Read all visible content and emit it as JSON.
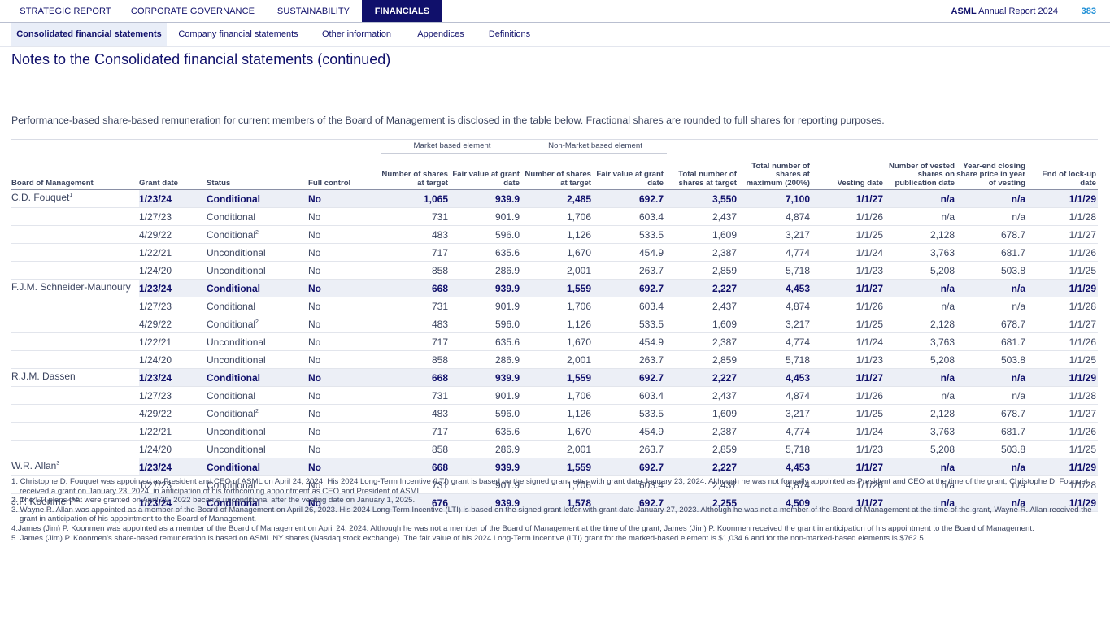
{
  "top_nav": {
    "tabs": [
      "STRATEGIC REPORT",
      "CORPORATE GOVERNANCE",
      "SUSTAINABILITY",
      "FINANCIALS"
    ],
    "active": 3,
    "brand_bold": "ASML",
    "brand_rest": " Annual Report 2024",
    "page_number": "383"
  },
  "sub_nav": {
    "tabs": [
      "Consolidated financial statements",
      "Company financial statements",
      "Other information",
      "Appendices",
      "Definitions"
    ],
    "active": 0
  },
  "page_title": "Notes to the Consolidated financial statements (continued)",
  "intro": "Performance-based share-based remuneration for current members of the Board of Management is disclosed in the table below. Fractional shares are rounded to full shares for reporting purposes.",
  "table": {
    "groups": {
      "market": "Market based element",
      "non_market": "Non-Market based element"
    },
    "headers": [
      "Board of Management",
      "Grant date",
      "Status",
      "Full control",
      "Number of shares at target",
      "Fair value at grant date",
      "Number of shares at target",
      "Fair value at grant date",
      "Total number of shares at target",
      "Total number of shares at maximum (200%)",
      "Vesting date",
      "Number of vested shares on publication date",
      "Year-end closing share price in year of vesting",
      "End of lock-up date"
    ],
    "members": [
      {
        "name": "C.D. Fouquet",
        "sup": "1",
        "rows": [
          {
            "grant": "1/23/24",
            "status": "Conditional",
            "ssup": "",
            "fc": "No",
            "m_shares": "1,065",
            "m_fv": "939.9",
            "n_shares": "2,485",
            "n_fv": "692.7",
            "total": "3,550",
            "max": "7,100",
            "vest": "1/1/27",
            "vested": "n/a",
            "price": "n/a",
            "lock": "1/1/29"
          },
          {
            "grant": "1/27/23",
            "status": "Conditional",
            "ssup": "",
            "fc": "No",
            "m_shares": "731",
            "m_fv": "901.9",
            "n_shares": "1,706",
            "n_fv": "603.4",
            "total": "2,437",
            "max": "4,874",
            "vest": "1/1/26",
            "vested": "n/a",
            "price": "n/a",
            "lock": "1/1/28"
          },
          {
            "grant": "4/29/22",
            "status": "Conditional",
            "ssup": "2",
            "fc": "No",
            "m_shares": "483",
            "m_fv": "596.0",
            "n_shares": "1,126",
            "n_fv": "533.5",
            "total": "1,609",
            "max": "3,217",
            "vest": "1/1/25",
            "vested": "2,128",
            "price": "678.7",
            "lock": "1/1/27"
          },
          {
            "grant": "1/22/21",
            "status": "Unconditional",
            "ssup": "",
            "fc": "No",
            "m_shares": "717",
            "m_fv": "635.6",
            "n_shares": "1,670",
            "n_fv": "454.9",
            "total": "2,387",
            "max": "4,774",
            "vest": "1/1/24",
            "vested": "3,763",
            "price": "681.7",
            "lock": "1/1/26"
          },
          {
            "grant": "1/24/20",
            "status": "Unconditional",
            "ssup": "",
            "fc": "No",
            "m_shares": "858",
            "m_fv": "286.9",
            "n_shares": "2,001",
            "n_fv": "263.7",
            "total": "2,859",
            "max": "5,718",
            "vest": "1/1/23",
            "vested": "5,208",
            "price": "503.8",
            "lock": "1/1/25"
          }
        ]
      },
      {
        "name": "F.J.M. Schneider-Maunoury",
        "sup": "",
        "rows": [
          {
            "grant": "1/23/24",
            "status": "Conditional",
            "ssup": "",
            "fc": "No",
            "m_shares": "668",
            "m_fv": "939.9",
            "n_shares": "1,559",
            "n_fv": "692.7",
            "total": "2,227",
            "max": "4,453",
            "vest": "1/1/27",
            "vested": "n/a",
            "price": "n/a",
            "lock": "1/1/29"
          },
          {
            "grant": "1/27/23",
            "status": "Conditional",
            "ssup": "",
            "fc": "No",
            "m_shares": "731",
            "m_fv": "901.9",
            "n_shares": "1,706",
            "n_fv": "603.4",
            "total": "2,437",
            "max": "4,874",
            "vest": "1/1/26",
            "vested": "n/a",
            "price": "n/a",
            "lock": "1/1/28"
          },
          {
            "grant": "4/29/22",
            "status": "Conditional",
            "ssup": "2",
            "fc": "No",
            "m_shares": "483",
            "m_fv": "596.0",
            "n_shares": "1,126",
            "n_fv": "533.5",
            "total": "1,609",
            "max": "3,217",
            "vest": "1/1/25",
            "vested": "2,128",
            "price": "678.7",
            "lock": "1/1/27"
          },
          {
            "grant": "1/22/21",
            "status": "Unconditional",
            "ssup": "",
            "fc": "No",
            "m_shares": "717",
            "m_fv": "635.6",
            "n_shares": "1,670",
            "n_fv": "454.9",
            "total": "2,387",
            "max": "4,774",
            "vest": "1/1/24",
            "vested": "3,763",
            "price": "681.7",
            "lock": "1/1/26"
          },
          {
            "grant": "1/24/20",
            "status": "Unconditional",
            "ssup": "",
            "fc": "No",
            "m_shares": "858",
            "m_fv": "286.9",
            "n_shares": "2,001",
            "n_fv": "263.7",
            "total": "2,859",
            "max": "5,718",
            "vest": "1/1/23",
            "vested": "5,208",
            "price": "503.8",
            "lock": "1/1/25"
          }
        ]
      },
      {
        "name": "R.J.M. Dassen",
        "sup": "",
        "rows": [
          {
            "grant": "1/23/24",
            "status": "Conditional",
            "ssup": "",
            "fc": "No",
            "m_shares": "668",
            "m_fv": "939.9",
            "n_shares": "1,559",
            "n_fv": "692.7",
            "total": "2,227",
            "max": "4,453",
            "vest": "1/1/27",
            "vested": "n/a",
            "price": "n/a",
            "lock": "1/1/29"
          },
          {
            "grant": "1/27/23",
            "status": "Conditional",
            "ssup": "",
            "fc": "No",
            "m_shares": "731",
            "m_fv": "901.9",
            "n_shares": "1,706",
            "n_fv": "603.4",
            "total": "2,437",
            "max": "4,874",
            "vest": "1/1/26",
            "vested": "n/a",
            "price": "n/a",
            "lock": "1/1/28"
          },
          {
            "grant": "4/29/22",
            "status": "Conditional",
            "ssup": "2",
            "fc": "No",
            "m_shares": "483",
            "m_fv": "596.0",
            "n_shares": "1,126",
            "n_fv": "533.5",
            "total": "1,609",
            "max": "3,217",
            "vest": "1/1/25",
            "vested": "2,128",
            "price": "678.7",
            "lock": "1/1/27"
          },
          {
            "grant": "1/22/21",
            "status": "Unconditional",
            "ssup": "",
            "fc": "No",
            "m_shares": "717",
            "m_fv": "635.6",
            "n_shares": "1,670",
            "n_fv": "454.9",
            "total": "2,387",
            "max": "4,774",
            "vest": "1/1/24",
            "vested": "3,763",
            "price": "681.7",
            "lock": "1/1/26"
          },
          {
            "grant": "1/24/20",
            "status": "Unconditional",
            "ssup": "",
            "fc": "No",
            "m_shares": "858",
            "m_fv": "286.9",
            "n_shares": "2,001",
            "n_fv": "263.7",
            "total": "2,859",
            "max": "5,718",
            "vest": "1/1/23",
            "vested": "5,208",
            "price": "503.8",
            "lock": "1/1/25"
          }
        ]
      },
      {
        "name": "W.R. Allan",
        "sup": "3",
        "rows": [
          {
            "grant": "1/23/24",
            "status": "Conditional",
            "ssup": "",
            "fc": "No",
            "m_shares": "668",
            "m_fv": "939.9",
            "n_shares": "1,559",
            "n_fv": "692.7",
            "total": "2,227",
            "max": "4,453",
            "vest": "1/1/27",
            "vested": "n/a",
            "price": "n/a",
            "lock": "1/1/29"
          },
          {
            "grant": "1/27/23",
            "status": "Conditional",
            "ssup": "",
            "fc": "No",
            "m_shares": "731",
            "m_fv": "901.9",
            "n_shares": "1,706",
            "n_fv": "603.4",
            "total": "2,437",
            "max": "4,874",
            "vest": "1/1/26",
            "vested": "n/a",
            "price": "n/a",
            "lock": "1/1/28"
          }
        ]
      },
      {
        "name": "J.P. Koonmen",
        "sup": "4,5",
        "rows": [
          {
            "grant": "1/23/24",
            "status": "Conditional",
            "ssup": "",
            "fc": "No",
            "m_shares": "676",
            "m_fv": "939.9",
            "n_shares": "1,578",
            "n_fv": "692.7",
            "total": "2,255",
            "max": "4,509",
            "vest": "1/1/27",
            "vested": "n/a",
            "price": "n/a",
            "lock": "1/1/29"
          }
        ]
      }
    ]
  },
  "footnotes": [
    "1. Christophe D. Fouquet was appointed as President and CEO of ASML on April 24, 2024. His 2024 Long-Term Incentive (LTI) grant is based on the signed grant letter with grant date January 23, 2024. Although he was not formally appointed as President and CEO at the time of the grant, Christophe D. Fouquet received a grant on January 23, 2024, in anticipation of his forthcoming appointment as CEO and President of ASML.",
    "2. The LTI plans that were granted on April 29, 2022 became unconditional after the vesting date on January 1, 2025.",
    "3.  Wayne R. Allan was appointed as a member of the Board of Management on April 26, 2023. His 2024 Long-Term Incentive (LTI) is based on the signed grant letter with grant date January 27, 2023. Although he was not a member of the Board of Management at the time of the grant, Wayne R. Allan received the grant in anticipation of his appointment to the Board of Management.",
    "4.James (Jim) P. Koonmen was appointed as a member of the Board of Management on April 24, 2024. Although he was not a member of the Board of Management at the time of the grant, James (Jim) P. Koonmen received the grant in anticipation of his appointment to the Board of Management.",
    "5. James (Jim) P. Koonmen's share-based remuneration is based on ASML NY shares (Nasdaq stock exchange). The fair value of his 2024 Long-Term Incentive (LTI) grant for the marked-based element is $1,034.6 and for the non-marked-based elements is $762.5."
  ]
}
